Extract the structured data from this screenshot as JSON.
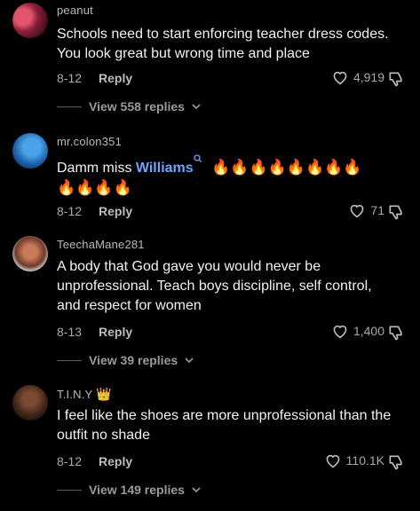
{
  "comments": [
    {
      "username": "peanut",
      "text": "Schools need to start enforcing teacher dress codes. You look great but wrong time and place",
      "date": "8-12",
      "reply_label": "Reply",
      "likes": "4,919",
      "view_replies": "View 558 replies"
    },
    {
      "username": "mr.colon351",
      "text_before": "Damm miss",
      "mention": "Williams",
      "fires_line1": "🔥🔥🔥🔥🔥🔥🔥🔥",
      "fires_line2": "🔥🔥🔥🔥",
      "date": "8-12",
      "reply_label": "Reply",
      "likes": "71"
    },
    {
      "username": "TeechaMane281",
      "text": "A body that God gave you would never be unprofessional. Teach boys discipline, self control, and respect for women",
      "date": "8-13",
      "reply_label": "Reply",
      "likes": "1,400",
      "view_replies": "View 39 replies"
    },
    {
      "username": "T.I.N.Y",
      "crown": "👑",
      "text": "I feel like the shoes are more unprofessional than the outfit no shade",
      "date": "8-12",
      "reply_label": "Reply",
      "likes": "110.1K",
      "view_replies": "View 149 replies"
    }
  ],
  "icons": {
    "heart": "heart-outline-icon",
    "dislike": "thumb-down-outline-icon",
    "chevron": "chevron-down-icon",
    "search": "search-icon"
  }
}
